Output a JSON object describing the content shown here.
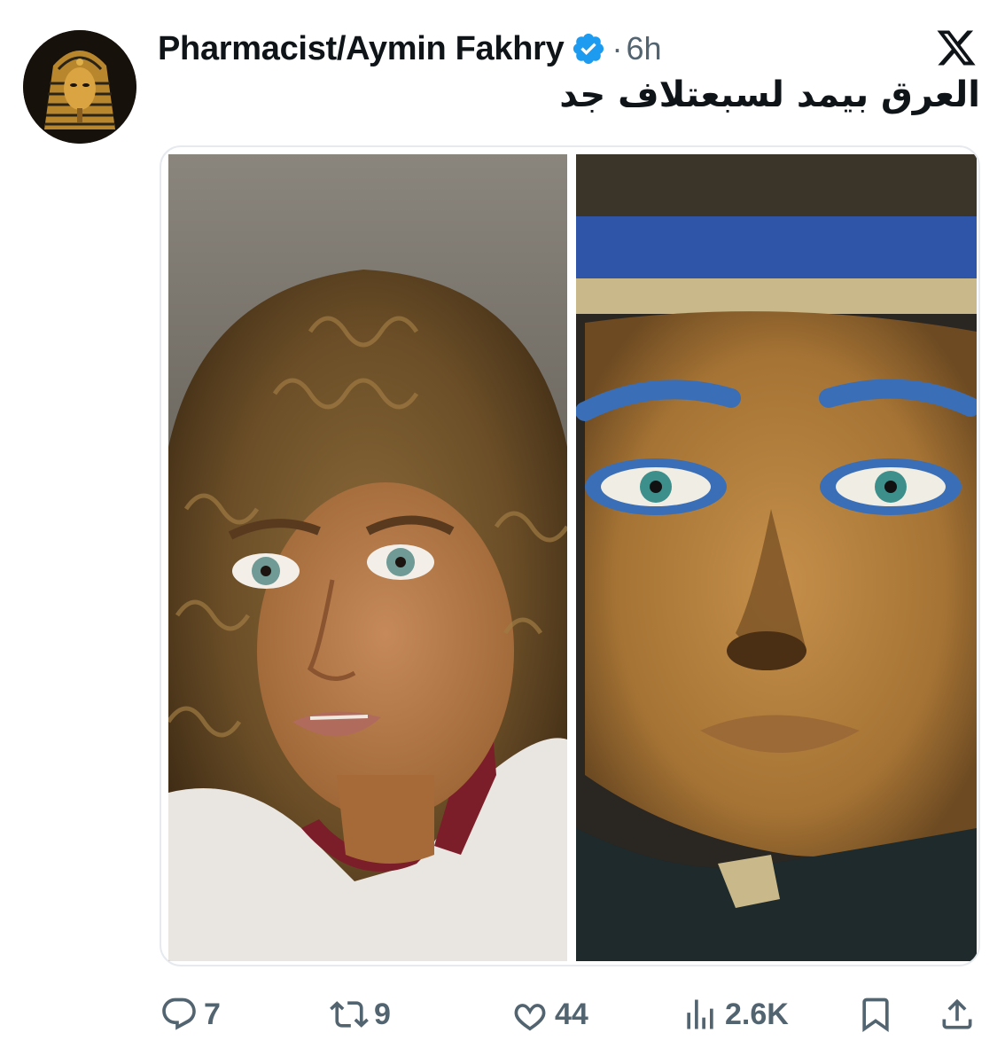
{
  "author": {
    "display_name": "Pharmacist/Aymin Fakhry",
    "separator": "·",
    "time": "6h",
    "avatar_icon": "pharaoh-mask-avatar",
    "verified_icon": "verified-badge-icon",
    "verified_color": "#1d9bf0"
  },
  "platform": {
    "logo_icon": "x-logo-icon"
  },
  "tweet": {
    "text": "العرق بيمد لسبعتلاف جد"
  },
  "media": {
    "images": [
      {
        "icon": "photo-girl-portrait"
      },
      {
        "icon": "photo-egyptian-mask"
      }
    ]
  },
  "actions": {
    "reply": {
      "icon": "reply-icon",
      "count": "7"
    },
    "retweet": {
      "icon": "retweet-icon",
      "count": "9"
    },
    "like": {
      "icon": "heart-icon",
      "count": "44"
    },
    "views": {
      "icon": "views-icon",
      "count": "2.6K"
    },
    "bookmark": {
      "icon": "bookmark-icon"
    },
    "share": {
      "icon": "share-icon"
    }
  },
  "colors": {
    "text_primary": "#0f1419",
    "text_secondary": "#536471",
    "border": "#e6eaee",
    "accent": "#1d9bf0"
  }
}
